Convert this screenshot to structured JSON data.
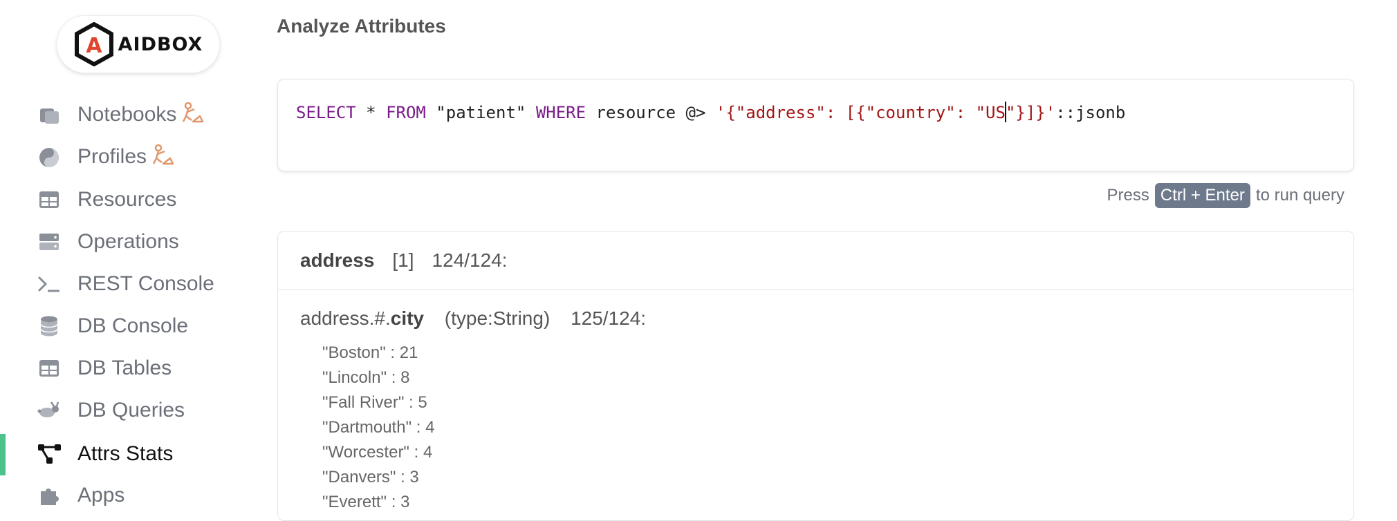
{
  "logo": {
    "text": "AIDBOX"
  },
  "sidebar": {
    "items": [
      {
        "label": "Notebooks",
        "icon": "notebook-icon",
        "wip": true
      },
      {
        "label": "Profiles",
        "icon": "yin-yang-icon",
        "wip": true
      },
      {
        "label": "Resources",
        "icon": "table-icon",
        "wip": false
      },
      {
        "label": "Operations",
        "icon": "server-icon",
        "wip": false
      },
      {
        "label": "REST Console",
        "icon": "terminal-icon",
        "wip": false
      },
      {
        "label": "DB Console",
        "icon": "database-icon",
        "wip": false
      },
      {
        "label": "DB Tables",
        "icon": "table-icon",
        "wip": false
      },
      {
        "label": "DB Queries",
        "icon": "rabbit-icon",
        "wip": false
      },
      {
        "label": "Attrs Stats",
        "icon": "graph-nodes-icon",
        "wip": false,
        "active": true
      },
      {
        "label": "Apps",
        "icon": "puzzle-icon",
        "wip": false
      }
    ]
  },
  "page": {
    "title": "Analyze Attributes"
  },
  "query": {
    "kw_select": "SELECT",
    "star": " * ",
    "kw_from": "FROM",
    "table": " \"patient\" ",
    "kw_where": "WHERE",
    "rest": " resource @> ",
    "json_before_caret": "'{\"address\": [{\"country\": \"US",
    "json_after_caret": "\"}]}'",
    "cast": "::jsonb"
  },
  "hint": {
    "press": "Press",
    "keys": "Ctrl + Enter",
    "suffix": "to run query"
  },
  "result": {
    "header_name": "address",
    "header_index": "[1]",
    "header_count": "124/124:",
    "attr_path": "address.#.",
    "attr_name": "city",
    "attr_type": "(type:String)",
    "attr_count": "125/124:",
    "values": [
      {
        "text": "\"Boston\"  :  21"
      },
      {
        "text": "\"Lincoln\"  :  8"
      },
      {
        "text": "\"Fall River\"  :  5"
      },
      {
        "text": "\"Dartmouth\"  :  4"
      },
      {
        "text": "\"Worcester\"  :  4"
      },
      {
        "text": "\"Danvers\"  :  3"
      },
      {
        "text": "\"Everett\"  :  3"
      }
    ]
  },
  "colors": {
    "active_bar": "#4cc38a",
    "keyword": "#7a1b8a",
    "string": "#a31515",
    "wip_icon": "#e0976a"
  }
}
